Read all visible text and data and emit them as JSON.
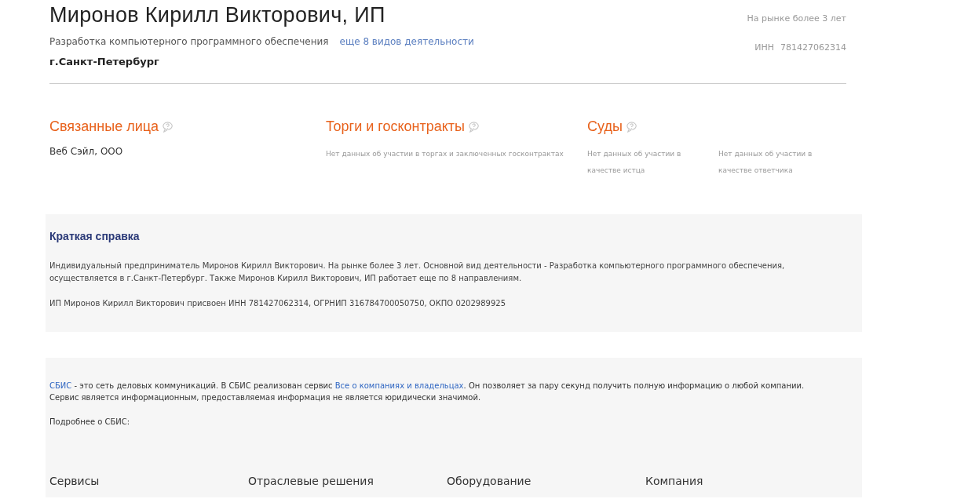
{
  "header": {
    "title": "Миронов Кирилл Викторович, ИП",
    "activity": "Разработка компьютерного программного обеспечения",
    "more_link": "еще 8 видов деятельности",
    "city": "г.Санкт-Петербург",
    "market_age": "На рынке более 3 лет",
    "inn_label": "ИНН",
    "inn": "781427062314"
  },
  "sections": [
    {
      "title": "Связанные лица",
      "kind": "list",
      "items": [
        "Веб Сэйл, ООО"
      ]
    },
    {
      "title": "Торги и госконтракты",
      "kind": "note",
      "items": [
        "Нет данных об участии в торгах и заключенных госконтрактах"
      ]
    },
    {
      "title": "Суды",
      "kind": "split",
      "items": [
        "Нет данных об участии в качестве истца",
        "Нет данных об участии в качестве ответчика"
      ]
    }
  ],
  "summary": {
    "title": "Краткая справка",
    "paragraphs": [
      "Индивидуальный предприниматель Миронов Кирилл Викторович. На рынке более 3 лет. Основной вид деятельности - Разработка компьютерного программного обеспечения, осуществляется в г.Санкт-Петербург. Также Миронов Кирилл Викторович, ИП работает еще по 8 направлениям.",
      "ИП Миронов Кирилл Викторович присвоен ИНН 781427062314, ОГРНИП 316784700050750, ОКПО 0202989925"
    ]
  },
  "footer": {
    "intro": [
      {
        "text": "СБИС",
        "link": true
      },
      {
        "text": " - это сеть деловых коммуникаций. В СБИС реализован сервис ",
        "link": false
      },
      {
        "text": "Все о компаниях и владельцах",
        "link": true
      },
      {
        "text": ". Он позволяет за пару секунд получить полную информацию о любой компании.",
        "link": false
      }
    ],
    "note": "Сервис является информационным, предоставляемая информация не является юридически значимой.",
    "more": "Подробнее о СБИС:",
    "columns": [
      "Сервисы",
      "Отраслевые решения",
      "Оборудование",
      "Компания"
    ]
  }
}
